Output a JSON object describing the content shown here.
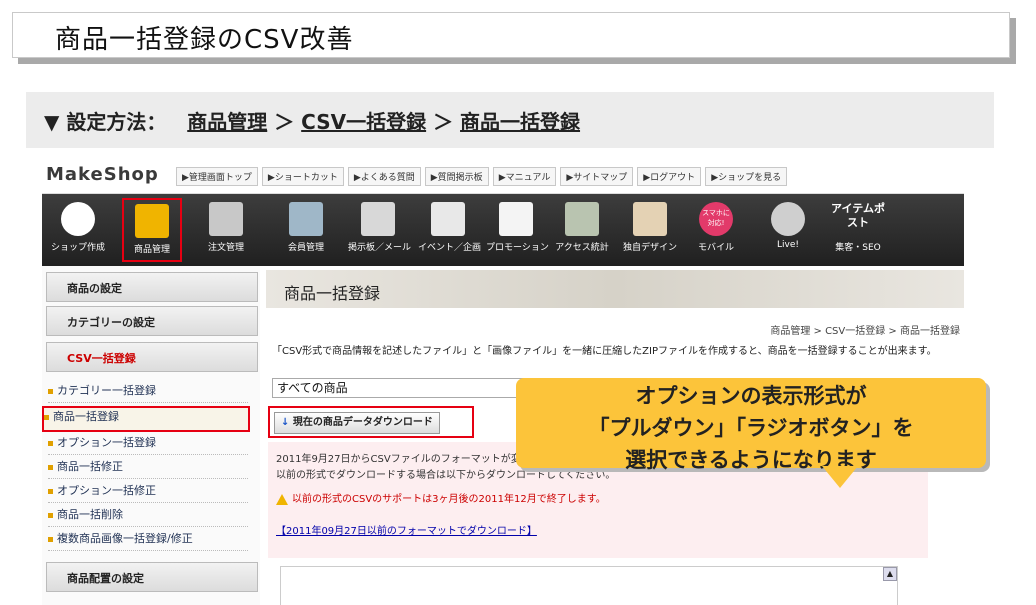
{
  "slide": {
    "title": "商品一括登録のCSV改善",
    "nav_prefix": "▼ 設定方法：",
    "nav_item1": "商品管理",
    "nav_sep1": "＞",
    "nav_item2": "CSV一括登録",
    "nav_sep2": "＞",
    "nav_item3": "商品一括登録"
  },
  "app": {
    "logo": "MakeShop",
    "top_links": [
      "▶管理画面トップ",
      "▶ショートカット",
      "▶よくある質問",
      "▶質問掲示板",
      "▶マニュアル",
      "▶サイトマップ",
      "▶ログアウト",
      "▶ショップを見る"
    ],
    "icon_menu": [
      {
        "label": "ショップ作成",
        "icon": "house-icon"
      },
      {
        "label": "商品管理",
        "icon": "box-icon"
      },
      {
        "label": "注文管理",
        "icon": "paper-icon"
      },
      {
        "label": "会員管理",
        "icon": "card-icon"
      },
      {
        "label": "掲示板／メール",
        "icon": "mail-icon"
      },
      {
        "label": "イベント／企画",
        "icon": "party-icon"
      },
      {
        "label": "プロモーション",
        "icon": "gift-icon"
      },
      {
        "label": "アクセス統計",
        "icon": "chart-icon"
      },
      {
        "label": "独自デザイン",
        "icon": "palette-icon"
      },
      {
        "label": "モバイル",
        "icon": "mobile-icon"
      },
      {
        "label": "Live!",
        "icon": "live-icon"
      },
      {
        "label": "集客・SEO",
        "icon": "seo-icon"
      }
    ],
    "mobile_badge": "スマホに対応!",
    "item_post_badge": "アイテムポスト"
  },
  "sidebar": {
    "sections": [
      "商品の設定",
      "カテゴリーの設定",
      "CSV一括登録",
      "商品配置の設定"
    ],
    "items": [
      "カテゴリー一括登録",
      "商品一括登録",
      "オプション一括登録",
      "商品一括修正",
      "オプション一括修正",
      "商品一括削除",
      "複数商品画像一括登録/修正"
    ]
  },
  "main": {
    "page_title": "商品一括登録",
    "breadcrumb": "商品管理 > CSV一括登録 > 商品一括登録",
    "description": "「CSV形式で商品情報を記述したファイル」と「画像ファイル」を一緒に圧縮したZIPファイルを作成すると、商品を一括登録することが出来ます。",
    "select_value": "すべての商品",
    "download_button": "現在の商品データダウンロード",
    "notice_line1": "2011年9月27日からCSVファイルのフォーマットが変わりました。",
    "notice_line2": "以前の形式でダウンロードする場合は以下からダウンロードしてください。",
    "notice_warning": "以前の形式のCSVのサポートは3ヶ月後の2011年12月で終了します。",
    "notice_link": "【2011年09月27日以前のフォーマットでダウンロード】"
  },
  "callout": {
    "line1": "オプションの表示形式が",
    "line2": "「プルダウン」「ラジオボタン」を",
    "line3": "選択できるようになります"
  },
  "colors": {
    "highlight": "#e60012",
    "callout": "#fcc43a"
  }
}
